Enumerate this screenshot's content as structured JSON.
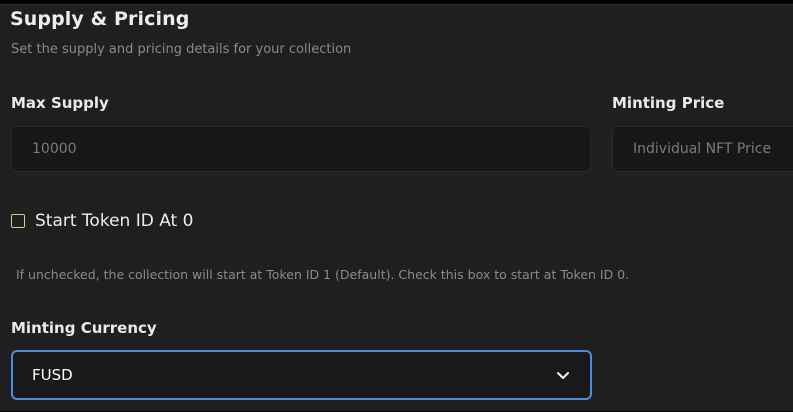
{
  "section": {
    "title": "Supply & Pricing",
    "subtitle": "Set the supply and pricing details for your collection"
  },
  "max_supply": {
    "label": "Max Supply",
    "placeholder": "10000",
    "value": ""
  },
  "minting_price": {
    "label": "Minting Price",
    "placeholder": "Individual NFT Price",
    "value": ""
  },
  "start_token": {
    "label": "Start Token ID At 0",
    "checked": false,
    "help_text": "If unchecked, the collection will start at Token ID 1 (Default). Check this box to start at Token ID 0."
  },
  "minting_currency": {
    "label": "Minting Currency",
    "selected": "FUSD",
    "icon": "chevron-down-icon"
  },
  "colors": {
    "background": "#1f1f1f",
    "input_background": "#171717",
    "focus_border": "#4b8ce0",
    "checkbox_border": "#d6c98a",
    "muted_text": "#8a8a8a"
  }
}
